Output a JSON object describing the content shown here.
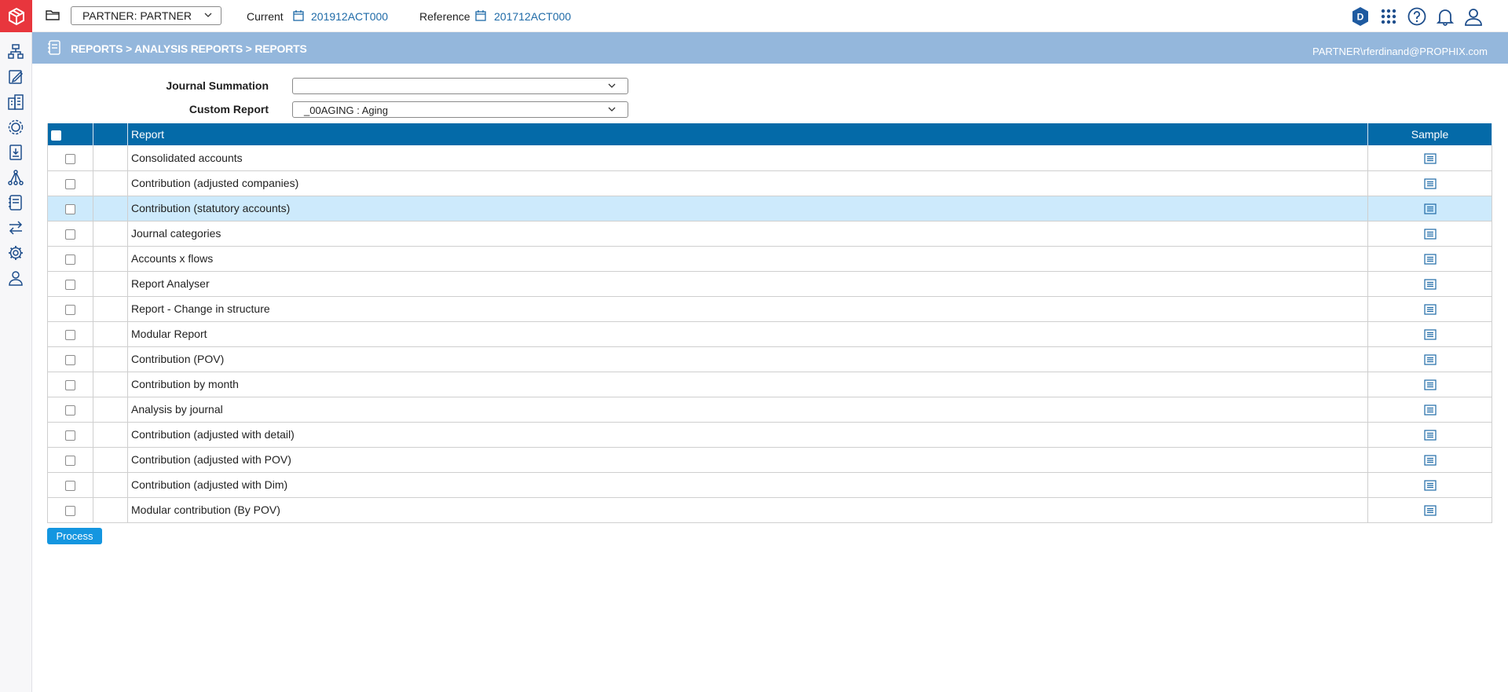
{
  "topbar": {
    "partner_value": "PARTNER: PARTNER",
    "current_label": "Current",
    "current_period": "201912ACT000",
    "reference_label": "Reference",
    "reference_period": "201712ACT000",
    "avatar_letter": "D"
  },
  "breadcrumb": {
    "path": "REPORTS > ANALYSIS REPORTS > REPORTS",
    "user": "PARTNER\\rferdinand@PROPHIX.com"
  },
  "form": {
    "journal_summation_label": "Journal Summation",
    "journal_summation_value": "",
    "custom_report_label": "Custom Report",
    "custom_report_value": "_00AGING : Aging"
  },
  "table": {
    "headers": {
      "report": "Report",
      "sample": "Sample"
    },
    "rows": [
      {
        "report": "Consolidated accounts"
      },
      {
        "report": "Contribution (adjusted companies)"
      },
      {
        "report": "Contribution (statutory accounts)",
        "selected": true
      },
      {
        "report": "Journal categories"
      },
      {
        "report": "Accounts x flows"
      },
      {
        "report": "Report Analyser"
      },
      {
        "report": "Report - Change in structure"
      },
      {
        "report": "Modular Report"
      },
      {
        "report": "Contribution (POV)"
      },
      {
        "report": "Contribution by month"
      },
      {
        "report": "Analysis by journal"
      },
      {
        "report": "Contribution (adjusted with detail)"
      },
      {
        "report": "Contribution (adjusted with POV)"
      },
      {
        "report": "Contribution (adjusted with Dim)"
      },
      {
        "report": "Modular contribution (By POV)"
      }
    ]
  },
  "actions": {
    "process_label": "Process"
  },
  "colors": {
    "brand_red": "#e8363d",
    "header_blue": "#046aa8",
    "crumb_blue": "#94b7dc",
    "selected_row": "#cdeafc",
    "process_button": "#1496e0",
    "link_blue": "#1e6aa7"
  },
  "icons": {
    "rail": [
      "org-chart-icon",
      "edit-document-icon",
      "buildings-icon",
      "gear-cluster-icon",
      "download-report-icon",
      "hierarchy-icon",
      "report-book-icon",
      "transfer-arrows-icon",
      "settings-gear-icon",
      "user-role-icon"
    ],
    "top": [
      "folder-icon",
      "calendar-icon",
      "avatar-badge-icon",
      "apps-grid-icon",
      "help-icon",
      "bell-icon",
      "user-icon"
    ]
  }
}
